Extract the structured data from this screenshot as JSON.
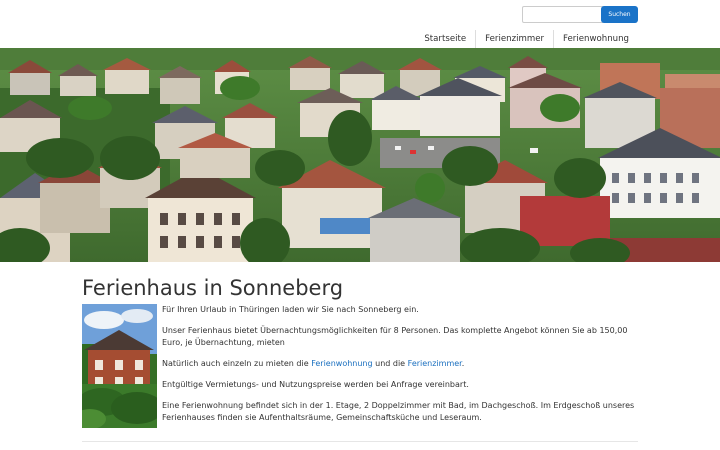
{
  "search": {
    "placeholder": "",
    "button_label": "Suchen"
  },
  "nav": {
    "items": [
      {
        "label": "Startseite"
      },
      {
        "label": "Ferienzimmer"
      },
      {
        "label": "Ferienwohnung"
      }
    ]
  },
  "page": {
    "title": "Ferienhaus in Sonneberg",
    "intro": "Für Ihren Urlaub in Thüringen laden wir Sie nach Sonneberg ein.",
    "offer": "Unser Ferienhaus bietet Übernachtungsmöglichkeiten für 8 Personen. Das komplette Angebot können Sie ab 150,00 Euro, je Übernachtung, mieten",
    "single_prefix": "Natürlich auch einzeln zu mieten die ",
    "link_ferienwohnung": "Ferienwohnung",
    "single_middle": " und die ",
    "link_ferienzimmer": "Ferienzimmer",
    "single_suffix": ".",
    "prices": "Entgültige Vermietungs- und Nutzungspreise werden bei Anfrage vereinbart.",
    "description": "Eine Ferienwohnung befindet sich in der 1. Etage, 2 Doppelzimmer mit Bad, im Dachgeschoß. Im Erdgeschoß unseres Ferienhauses finden sie Aufenthaltsräume, Gemeinschaftsküche und Leseraum."
  },
  "colors": {
    "accent": "#1a73c8",
    "link": "#1a6fbf"
  }
}
